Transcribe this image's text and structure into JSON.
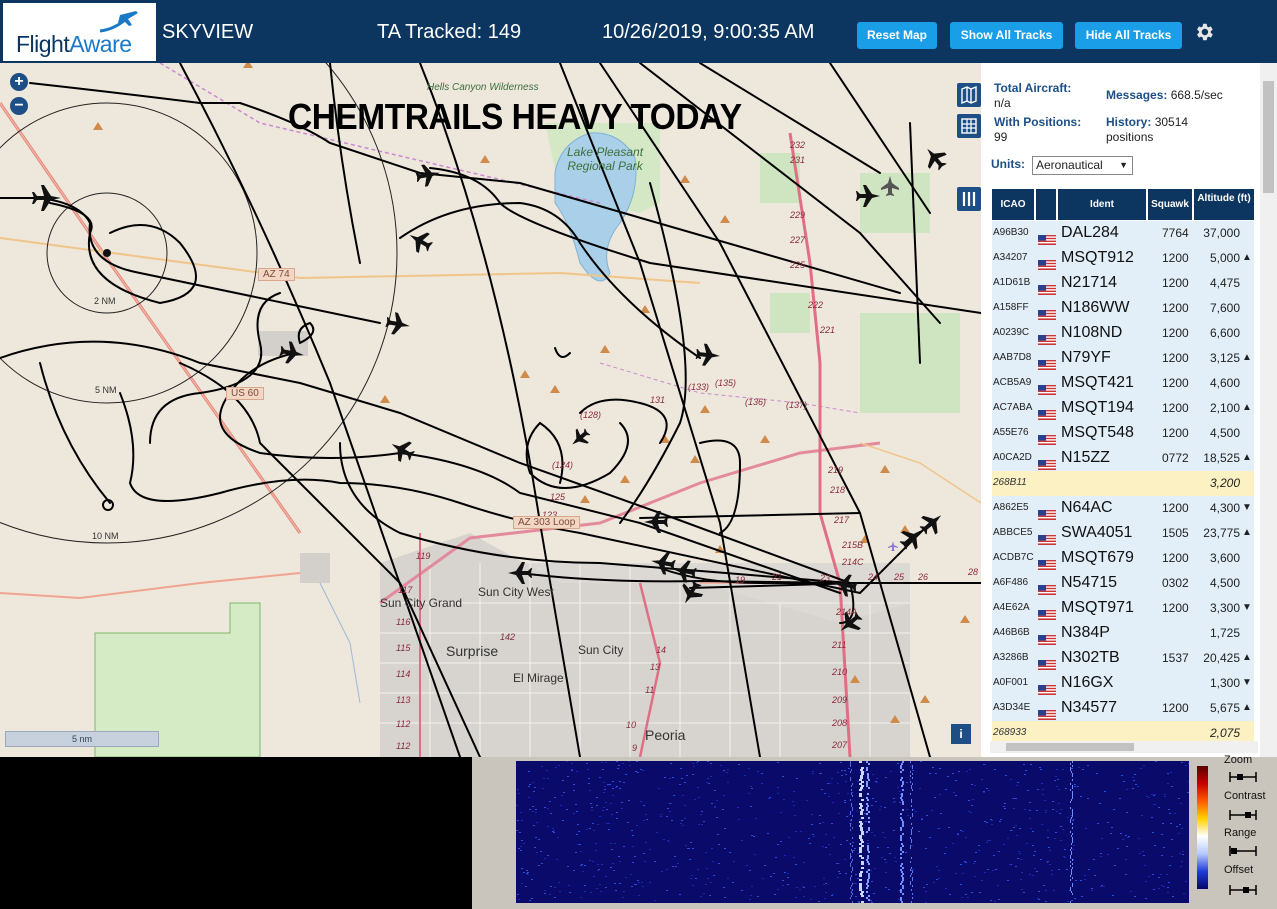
{
  "header": {
    "logo_text_a": "Flight",
    "logo_text_b": "Aware",
    "title": "SKYVIEW",
    "tracked": "TA Tracked: 149",
    "datetime": "10/26/2019, 9:00:35 AM",
    "buttons": {
      "reset": "Reset Map",
      "show": "Show All Tracks",
      "hide": "Hide All Tracks"
    },
    "settings_icon": "gear-icon"
  },
  "map": {
    "overlay_text": "CHEMTRAILS HEAVY TODAY",
    "zoom_in": "+",
    "zoom_out": "−",
    "scale_label": "5 nm",
    "range_rings": [
      "2 NM",
      "5 NM",
      "10 NM"
    ],
    "places": {
      "hells": "Hells Canyon Wilderness",
      "lake": "Lake Pleasant Regional Park",
      "sun_city_grand": "Sun City Grand",
      "sun_city_west": "Sun City West",
      "sun_city": "Sun City",
      "surprise": "Surprise",
      "el_mirage": "El Mirage",
      "peoria": "Peoria"
    },
    "roads": {
      "az74": "AZ 74",
      "us60": "US 60",
      "az303": "AZ 303 Loop"
    },
    "info": "i"
  },
  "stats": {
    "total_label": "Total Aircraft:",
    "total_value": "n/a",
    "pos_label": "With Positions:",
    "pos_value": "99",
    "msg_label": "Messages:",
    "msg_value": "668.5/sec",
    "hist_label": "History:",
    "hist_value": "30514",
    "hist_unit": "positions",
    "units_label": "Units:",
    "units_value": "Aeronautical"
  },
  "table": {
    "headers": {
      "icao": "ICAO",
      "ident": "Ident",
      "squawk": "Squawk",
      "alt": "Altitude (ft)"
    },
    "rows": [
      {
        "icao": "A96B30",
        "ident": "DAL284",
        "squawk": "7764",
        "alt": "37,000",
        "trend": "",
        "hl": false,
        "flag": true
      },
      {
        "icao": "A34207",
        "ident": "MSQT912",
        "squawk": "1200",
        "alt": "5,000",
        "trend": "▲",
        "hl": false,
        "flag": true
      },
      {
        "icao": "A1D61B",
        "ident": "N21714",
        "squawk": "1200",
        "alt": "4,475",
        "trend": "",
        "hl": false,
        "flag": true
      },
      {
        "icao": "A158FF",
        "ident": "N186WW",
        "squawk": "1200",
        "alt": "7,600",
        "trend": "",
        "hl": false,
        "flag": true
      },
      {
        "icao": "A0239C",
        "ident": "N108ND",
        "squawk": "1200",
        "alt": "6,600",
        "trend": "",
        "hl": false,
        "flag": true
      },
      {
        "icao": "AAB7D8",
        "ident": "N79YF",
        "squawk": "1200",
        "alt": "3,125",
        "trend": "▲",
        "hl": false,
        "flag": true
      },
      {
        "icao": "ACB5A9",
        "ident": "MSQT421",
        "squawk": "1200",
        "alt": "4,600",
        "trend": "",
        "hl": false,
        "flag": true
      },
      {
        "icao": "AC7ABA",
        "ident": "MSQT194",
        "squawk": "1200",
        "alt": "2,100",
        "trend": "▲",
        "hl": false,
        "flag": true
      },
      {
        "icao": "A55E76",
        "ident": "MSQT548",
        "squawk": "1200",
        "alt": "4,500",
        "trend": "",
        "hl": false,
        "flag": true
      },
      {
        "icao": "A0CA2D",
        "ident": "N15ZZ",
        "squawk": "0772",
        "alt": "18,525",
        "trend": "▲",
        "hl": false,
        "flag": true
      },
      {
        "icao": "268B11",
        "ident": "",
        "squawk": "",
        "alt": "3,200",
        "trend": "",
        "hl": true,
        "flag": false
      },
      {
        "icao": "A862E5",
        "ident": "N64AC",
        "squawk": "1200",
        "alt": "4,300",
        "trend": "▼",
        "hl": false,
        "flag": true
      },
      {
        "icao": "ABBCE5",
        "ident": "SWA4051",
        "squawk": "1505",
        "alt": "23,775",
        "trend": "▲",
        "hl": false,
        "flag": true
      },
      {
        "icao": "ACDB7C",
        "ident": "MSQT679",
        "squawk": "1200",
        "alt": "3,600",
        "trend": "",
        "hl": false,
        "flag": true
      },
      {
        "icao": "A6F486",
        "ident": "N54715",
        "squawk": "0302",
        "alt": "4,500",
        "trend": "",
        "hl": false,
        "flag": true
      },
      {
        "icao": "A4E62A",
        "ident": "MSQT971",
        "squawk": "1200",
        "alt": "3,300",
        "trend": "▼",
        "hl": false,
        "flag": true
      },
      {
        "icao": "A46B6B",
        "ident": "N384P",
        "squawk": "",
        "alt": "1,725",
        "trend": "",
        "hl": false,
        "flag": true
      },
      {
        "icao": "A3286B",
        "ident": "N302TB",
        "squawk": "1537",
        "alt": "20,425",
        "trend": "▲",
        "hl": false,
        "flag": true
      },
      {
        "icao": "A0F001",
        "ident": "N16GX",
        "squawk": "",
        "alt": "1,300",
        "trend": "▼",
        "hl": false,
        "flag": true
      },
      {
        "icao": "A3D34E",
        "ident": "N34577",
        "squawk": "1200",
        "alt": "5,675",
        "trend": "▲",
        "hl": false,
        "flag": true
      },
      {
        "icao": "268933",
        "ident": "",
        "squawk": "",
        "alt": "2,075",
        "trend": "",
        "hl": true,
        "flag": false
      }
    ]
  },
  "spectrum": {
    "labels": {
      "zoom": "Zoom",
      "contrast": "Contrast",
      "range": "Range",
      "offset": "Offset"
    }
  }
}
